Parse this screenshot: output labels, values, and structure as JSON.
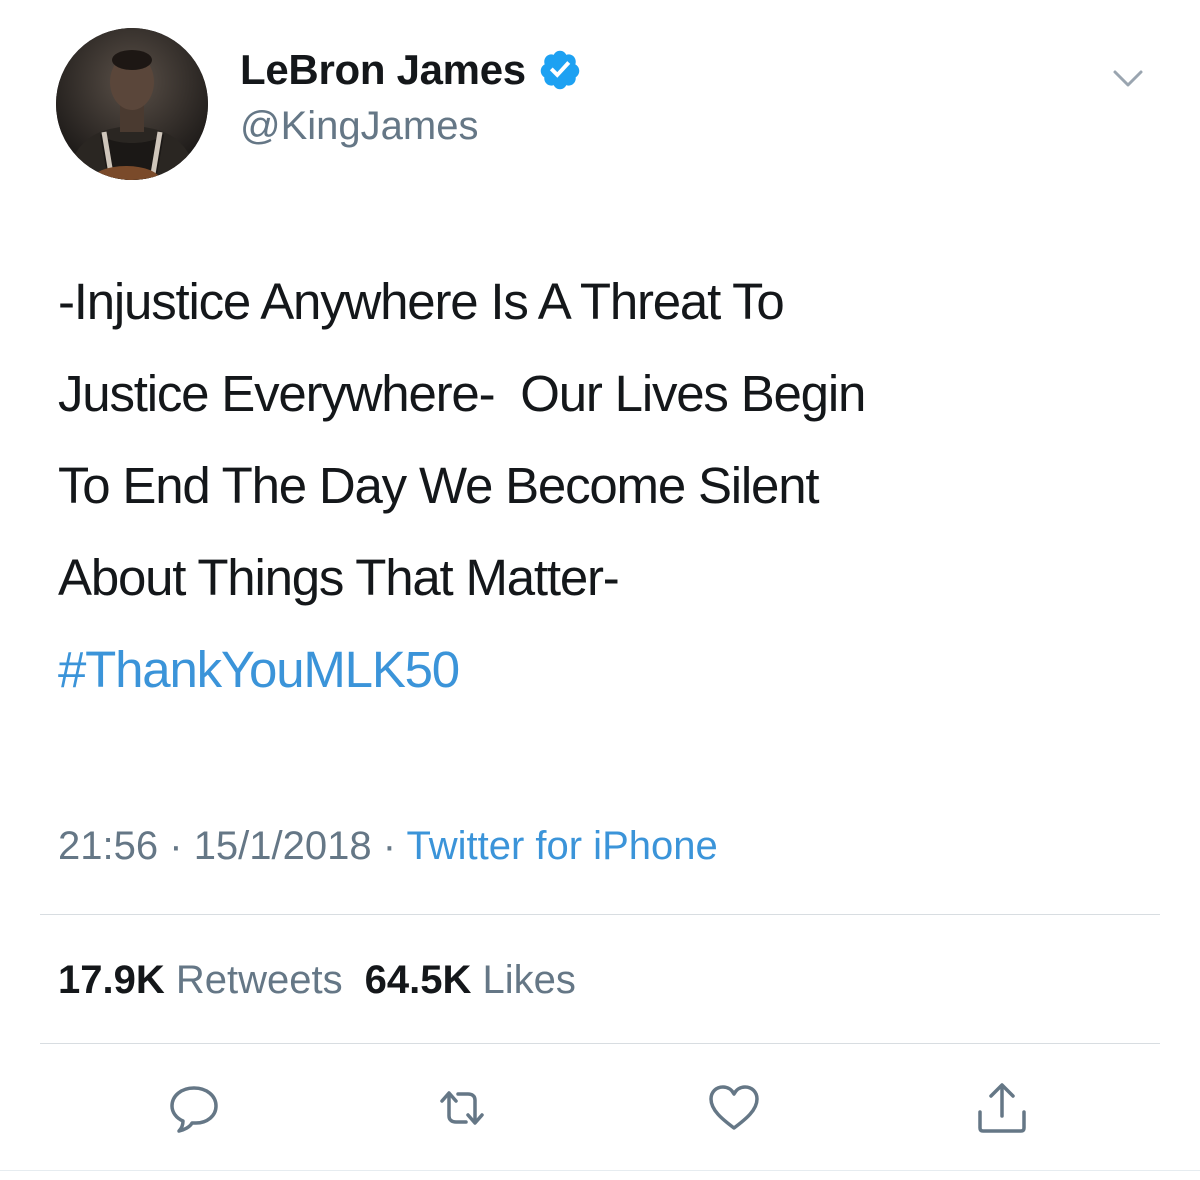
{
  "author": {
    "display_name": "LeBron James",
    "handle": "@KingJames",
    "verified": true,
    "avatar_icon": "profile-photo-basketball-player"
  },
  "tweet": {
    "lines": [
      "-Injustice Anywhere Is A Threat To",
      "Justice Everywhere-  Our Lives Begin",
      "To End The Day We Become Silent",
      "About Things That Matter-"
    ],
    "hashtag": "#ThankYouMLK50"
  },
  "meta": {
    "time": "21:56",
    "separator": "·",
    "date": "15/1/2018",
    "source": "Twitter for iPhone"
  },
  "stats": {
    "retweets_count": "17.9K",
    "retweets_label": "Retweets",
    "likes_count": "64.5K",
    "likes_label": "Likes"
  },
  "actions": {
    "reply_icon": "reply-icon",
    "retweet_icon": "retweet-icon",
    "like_icon": "heart-icon",
    "share_icon": "share-icon"
  },
  "colors": {
    "text": "#14171a",
    "secondary": "#657786",
    "link": "#3b94d9",
    "verified_badge": "#1da1f2",
    "divider": "#d8dde1"
  }
}
